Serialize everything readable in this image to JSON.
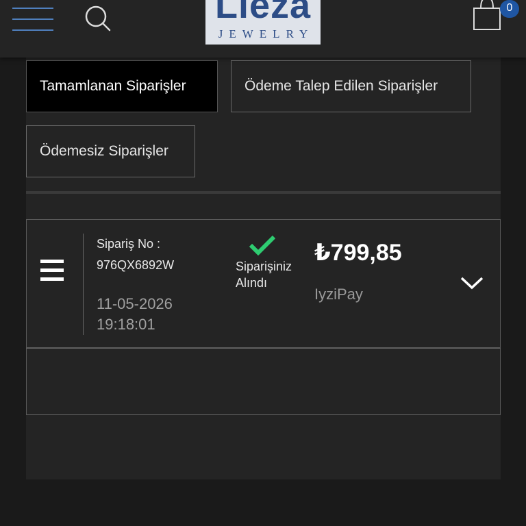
{
  "header": {
    "brand_name": "Lieza",
    "brand_sub": "JEWELRY",
    "cart_count": "0",
    "icons": {
      "menu": "hamburger-icon",
      "search": "search-icon",
      "cart": "shopping-bag-icon"
    }
  },
  "filters": {
    "completed": "Tamamlanan Siparişler",
    "payment_requested": "Ödeme Talep Edilen Siparişler",
    "unpaid": "Ödemesiz Siparişler",
    "active": "completed"
  },
  "order": {
    "number_label": "Sipariş No :",
    "number": "976QX6892W",
    "date": "11-05-2026",
    "time": "19:18:01",
    "status_line1": "Siparişiniz",
    "status_line2": "Alındı",
    "amount": "₺799,85",
    "payment_method": "IyziPay"
  },
  "colors": {
    "background": "#1a1a1a",
    "panel": "#242424",
    "accent_blue": "#4f7fbd",
    "badge_blue": "#1f56a3",
    "success_green": "#2ecc71"
  }
}
